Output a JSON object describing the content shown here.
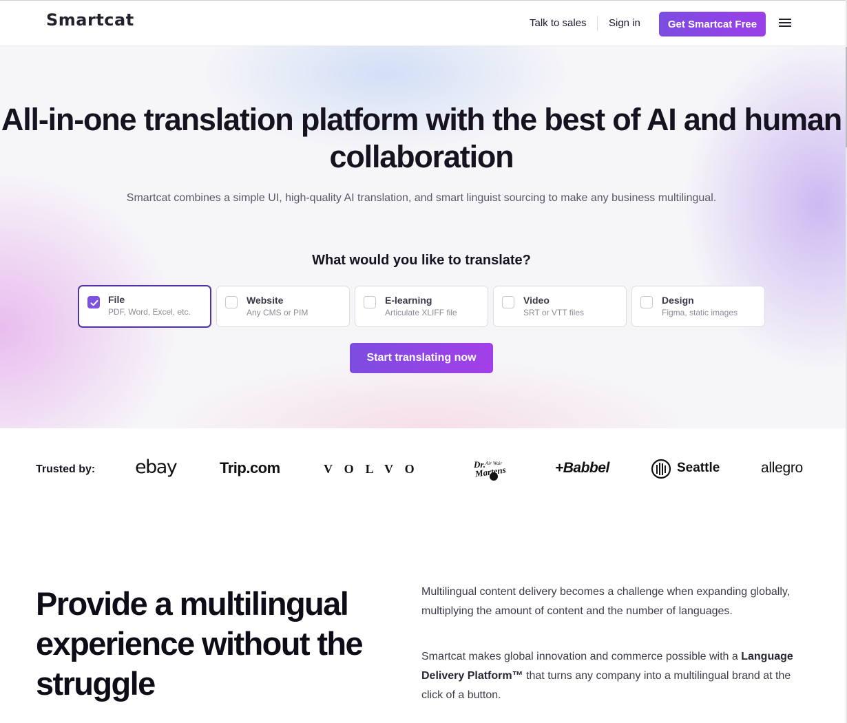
{
  "header": {
    "logo": "Smartcat",
    "talk_to_sales": "Talk to sales",
    "sign_in": "Sign in",
    "cta": "Get Smartcat Free",
    "menu_icon": "hamburger-menu-icon"
  },
  "hero": {
    "title": "All-in-one translation platform with the best of AI and human collaboration",
    "subtitle": "Smartcat combines a simple UI, high-quality AI translation, and smart linguist sourcing to make any business multilingual.",
    "question": "What would you like to translate?",
    "options": [
      {
        "title": "File",
        "desc": "PDF, Word, Excel, etc.",
        "selected": true
      },
      {
        "title": "Website",
        "desc": "Any CMS or PIM",
        "selected": false
      },
      {
        "title": "E-learning",
        "desc": "Articulate XLIFF file",
        "selected": false
      },
      {
        "title": "Video",
        "desc": "SRT or VTT files",
        "selected": false
      },
      {
        "title": "Design",
        "desc": "Figma, static images",
        "selected": false
      }
    ],
    "cta": "Start translating now"
  },
  "trusted": {
    "label": "Trusted by:",
    "brands": [
      "ebay",
      "Trip.com",
      "VOLVO",
      "Dr. Martens",
      "+Babbel",
      "Seattle",
      "allegro"
    ]
  },
  "provide": {
    "title": "Provide a multilingual experience without the struggle",
    "p1": "Multilingual content delivery becomes a challenge when expanding globally, multiplying the amount of content and the number of languages.",
    "p2_before": "Smartcat makes global innovation and commerce possible with a ",
    "p2_strong": "Language Delivery Platform™",
    "p2_after": " that turns any company into a multilingual brand at the click of a button."
  },
  "colors": {
    "accent_start": "#7c4ce0",
    "accent_end": "#a33fe8",
    "selected_border": "#4f32a8",
    "text_dark": "#17121f"
  }
}
